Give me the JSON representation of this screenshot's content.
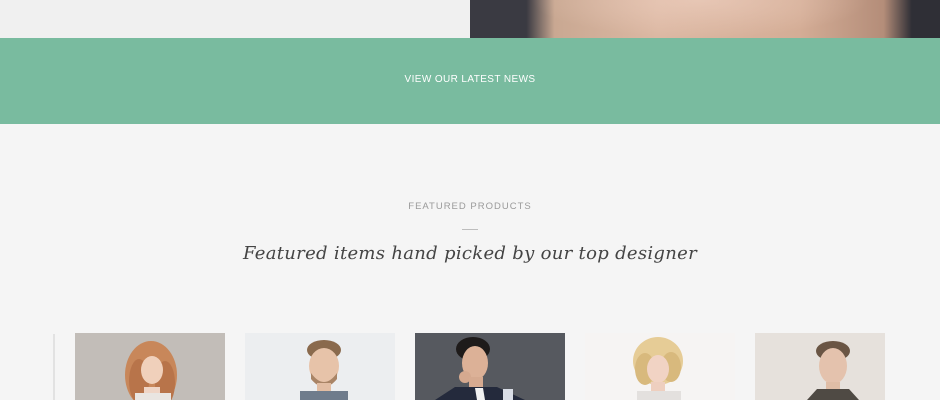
{
  "news": {
    "label": "VIEW OUR LATEST NEWS"
  },
  "featured": {
    "eyebrow": "FEATURED PRODUCTS",
    "heading": "Featured items hand picked by our top designer"
  },
  "products": [
    {
      "icon": "woman-curly-hair-photo"
    },
    {
      "icon": "man-smiling-photo"
    },
    {
      "icon": "man-dark-jacket-photo"
    },
    {
      "icon": "woman-blonde-bob-photo"
    },
    {
      "icon": "man-short-hair-photo"
    }
  ],
  "colors": {
    "accent_band": "#79bb9f",
    "page_background": "#f5f5f5",
    "heading_text": "#444444",
    "eyebrow_text": "#9a9a9a"
  }
}
